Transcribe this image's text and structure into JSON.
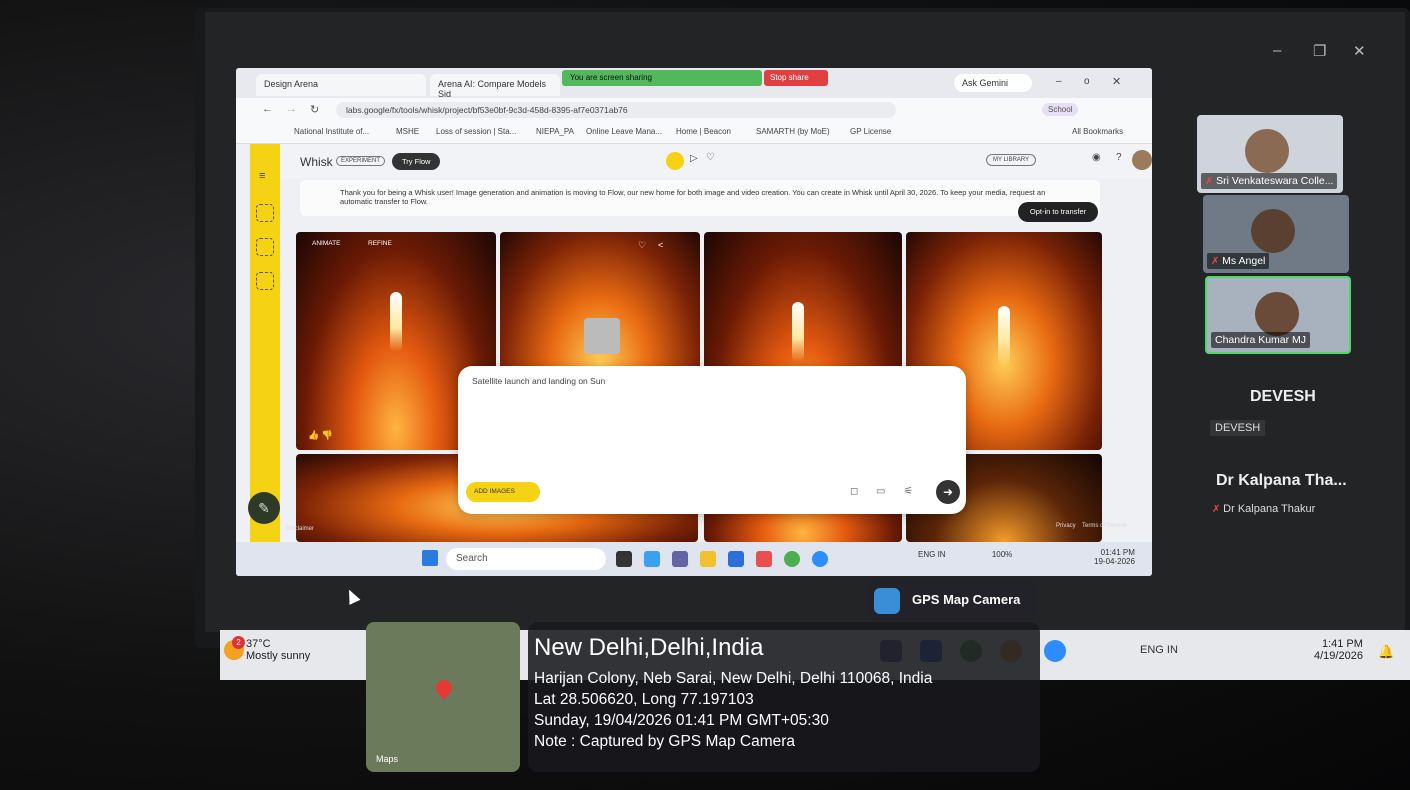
{
  "browser": {
    "tabs": [
      "Design Arena",
      "Arena AI: Compare Models Sid"
    ],
    "screen_sharing_text": "You are screen sharing",
    "stop_share_label": "Stop share",
    "ask_gemini_label": "Ask Gemini",
    "url": "labs.google/fx/tools/whisk/project/bf53e0bf-9c3d-458d-8395-af7e0371ab76",
    "profile_label": "School",
    "bookmarks": [
      "National Institute of...",
      "MSHE",
      "Loss of session | Sta...",
      "NIEPA_PA",
      "Online Leave Mana...",
      "Home | Beacon",
      "SAMARTH (by MoE)",
      "GP License",
      "All Bookmarks"
    ]
  },
  "whisk": {
    "app_name": "Whisk",
    "experiment_badge": "EXPERIMENT",
    "try_flow_label": "Try Flow",
    "my_library_label": "MY LIBRARY",
    "banner_text": "Thank you for being a Whisk user! Image generation and animation is moving to Flow, our new home for both image and video creation. You can create in Whisk until April 30, 2026. To keep your media, request an automatic transfer to Flow.",
    "optin_label": "Opt-in to transfer",
    "animate_label": "ANIMATE",
    "refine_label": "REFINE",
    "prompt_text": "Satellite launch and landing on Sun",
    "add_images_label": "ADD IMAGES",
    "disclaimer": "Disclaimer",
    "privacy": "Privacy",
    "terms": "Terms of Service"
  },
  "inner_taskbar": {
    "search_placeholder": "Search",
    "lang": "ENG",
    "region": "IN",
    "battery": "100%",
    "time": "01:41 PM",
    "date": "19-04-2026"
  },
  "participants": [
    {
      "name": "Sri Venkateswara Colle..."
    },
    {
      "name": "Ms Angel"
    },
    {
      "name": "Chandra Kumar MJ"
    }
  ],
  "speaker_devesh": {
    "name": "DEVESH",
    "sub": "DEVESH"
  },
  "speaker_kalpana": {
    "name": "Dr Kalpana Tha...",
    "sub": "Dr Kalpana Thakur"
  },
  "outer_taskbar": {
    "weather_temp": "37°C",
    "weather_desc": "Mostly sunny",
    "weather_badge": "2",
    "lang": "ENG",
    "region": "IN",
    "time": "1:41 PM",
    "date": "4/19/2026"
  },
  "gps": {
    "app_label": "GPS Map Camera",
    "city": "New Delhi,Delhi,India",
    "address": "Harijan Colony, Neb Sarai, New Delhi, Delhi 110068, India",
    "latlong": "Lat 28.506620, Long 77.197103",
    "datetime": "Sunday, 19/04/2026 01:41 PM GMT+05:30",
    "note": "Note : Captured by GPS Map Camera",
    "maps_label": "Maps"
  }
}
